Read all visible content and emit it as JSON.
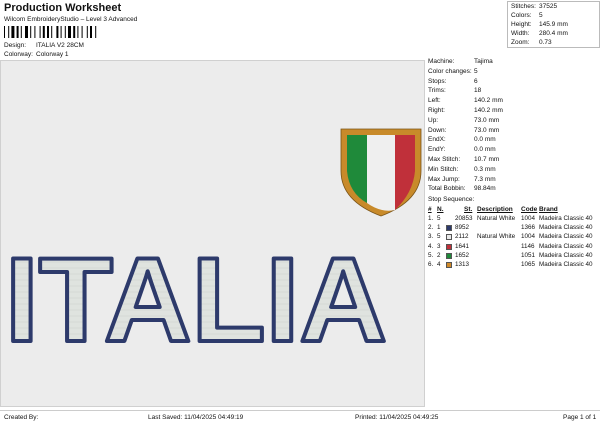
{
  "header": {
    "title": "Production Worksheet",
    "subtitle": "Wilcom EmbroideryStudio – Level 3 Advanced",
    "design_label": "Design:",
    "design_value": "ITALIA V2 28CM",
    "colorway_label": "Colorway:",
    "colorway_value": "Colorway 1"
  },
  "stats": [
    {
      "label": "Stitches:",
      "value": "37525"
    },
    {
      "label": "Colors:",
      "value": "5"
    },
    {
      "label": "Height:",
      "value": "145.9 mm"
    },
    {
      "label": "Width:",
      "value": "280.4 mm"
    },
    {
      "label": "Zoom:",
      "value": "0.73"
    }
  ],
  "design": {
    "text": "ITALIA",
    "fill_color": "#dfe3df",
    "outline_color": "#2d3a6b",
    "shield_colors": {
      "border": "#c88a2a",
      "green": "#1f8a3a",
      "white": "#efefef",
      "red": "#c0303a"
    }
  },
  "info": [
    {
      "label": "Machine:",
      "value": "Tajima"
    },
    {
      "label": "Color changes:",
      "value": "5"
    },
    {
      "label": "Stops:",
      "value": "6"
    },
    {
      "label": "Trims:",
      "value": "18"
    },
    {
      "label": "Left:",
      "value": "140.2 mm"
    },
    {
      "label": "Right:",
      "value": "140.2 mm"
    },
    {
      "label": "Up:",
      "value": "73.0 mm"
    },
    {
      "label": "Down:",
      "value": "73.0 mm"
    },
    {
      "label": "EndX:",
      "value": "0.0 mm"
    },
    {
      "label": "EndY:",
      "value": "0.0 mm"
    },
    {
      "label": "Max Stitch:",
      "value": "10.7 mm"
    },
    {
      "label": "Min Stitch:",
      "value": "0.3 mm"
    },
    {
      "label": "Max Jump:",
      "value": "7.3 mm"
    },
    {
      "label": "Total Bobbin:",
      "value": "98.84m"
    }
  ],
  "stop_sequence": {
    "header": "Stop Sequence:",
    "columns": {
      "num": "#",
      "n": "N.",
      "st": "St.",
      "description": "Description",
      "code": "Code",
      "brand": "Brand"
    },
    "rows": [
      {
        "num": "1.",
        "n": "5",
        "color": "",
        "st": "20853",
        "description": "Natural White",
        "code": "1004",
        "brand": "Madeira Classic 40"
      },
      {
        "num": "2.",
        "n": "1",
        "color": "#2d3a6b",
        "st": "8952",
        "description": "",
        "code": "1366",
        "brand": "Madeira Classic 40"
      },
      {
        "num": "3.",
        "n": "5",
        "color": "#e8e8e8",
        "st": "2112",
        "description": "Natural White",
        "code": "1004",
        "brand": "Madeira Classic 40"
      },
      {
        "num": "4.",
        "n": "3",
        "color": "#c0303a",
        "st": "1641",
        "description": "",
        "code": "1146",
        "brand": "Madeira Classic 40"
      },
      {
        "num": "5.",
        "n": "2",
        "color": "#1f8a3a",
        "st": "1652",
        "description": "",
        "code": "1051",
        "brand": "Madeira Classic 40"
      },
      {
        "num": "6.",
        "n": "4",
        "color": "#d08a2a",
        "st": "1313",
        "description": "",
        "code": "1065",
        "brand": "Madeira Classic 40"
      }
    ]
  },
  "footer": {
    "created_by": "Created By:",
    "last_saved": "Last Saved: 11/04/2025 04:49:19",
    "printed": "Printed: 11/04/2025 04:49:25",
    "page": "Page 1 of 1"
  }
}
